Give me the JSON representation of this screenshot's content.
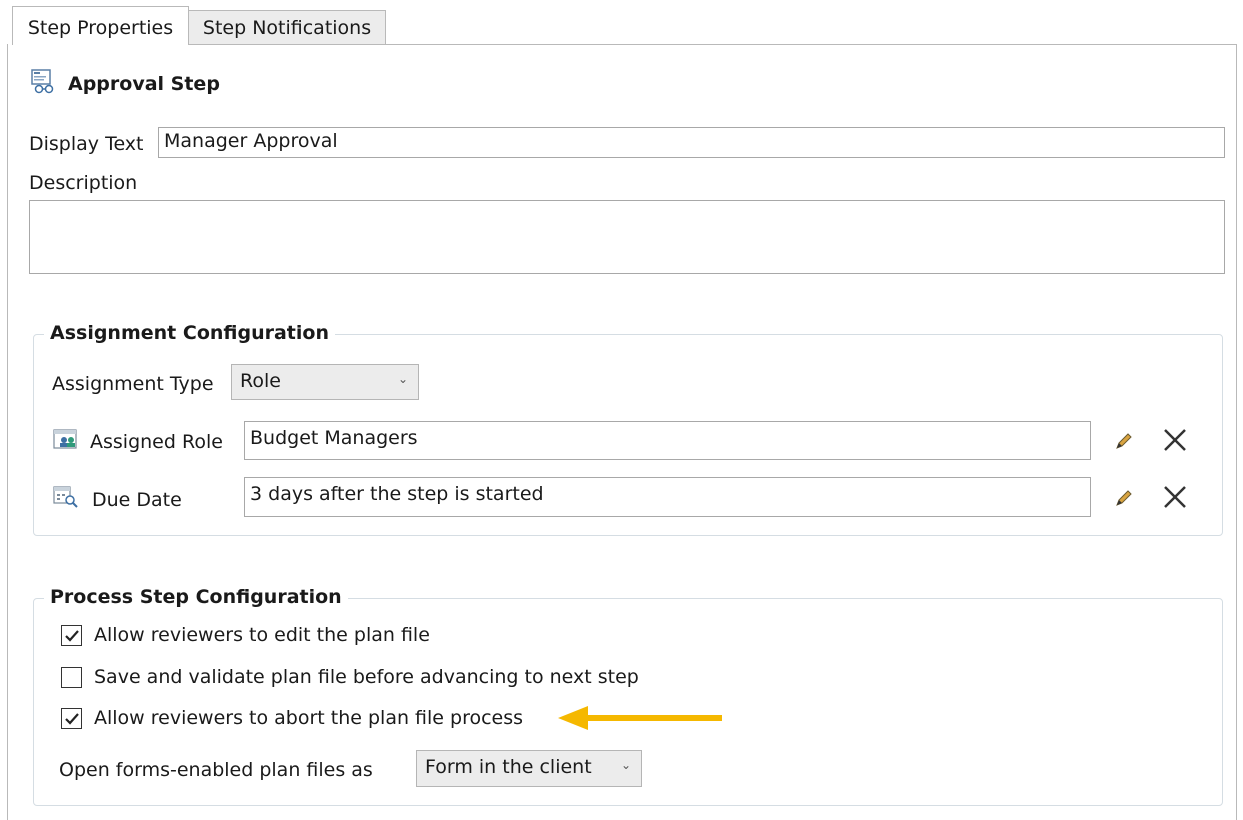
{
  "tabs": [
    {
      "label": "Step Properties"
    },
    {
      "label": "Step Notifications"
    }
  ],
  "header": {
    "title": "Approval Step"
  },
  "display_text": {
    "label": "Display Text",
    "value": "Manager Approval"
  },
  "description": {
    "label": "Description",
    "value": ""
  },
  "assignment": {
    "title": "Assignment Configuration",
    "type_label": "Assignment Type",
    "type_value": "Role",
    "role_label": "Assigned Role",
    "role_value": "Budget Managers",
    "due_label": "Due Date",
    "due_value": "3 days after the step is started"
  },
  "process": {
    "title": "Process Step Configuration",
    "options": [
      {
        "label": "Allow reviewers to edit the plan file",
        "checked": true
      },
      {
        "label": "Save and validate plan file before advancing to next step",
        "checked": false
      },
      {
        "label": "Allow reviewers to abort the plan file process",
        "checked": true
      }
    ],
    "open_as_label": "Open forms-enabled plan files as",
    "open_as_value": "Form in the client"
  },
  "colors": {
    "accent_arrow": "#f5b800"
  }
}
